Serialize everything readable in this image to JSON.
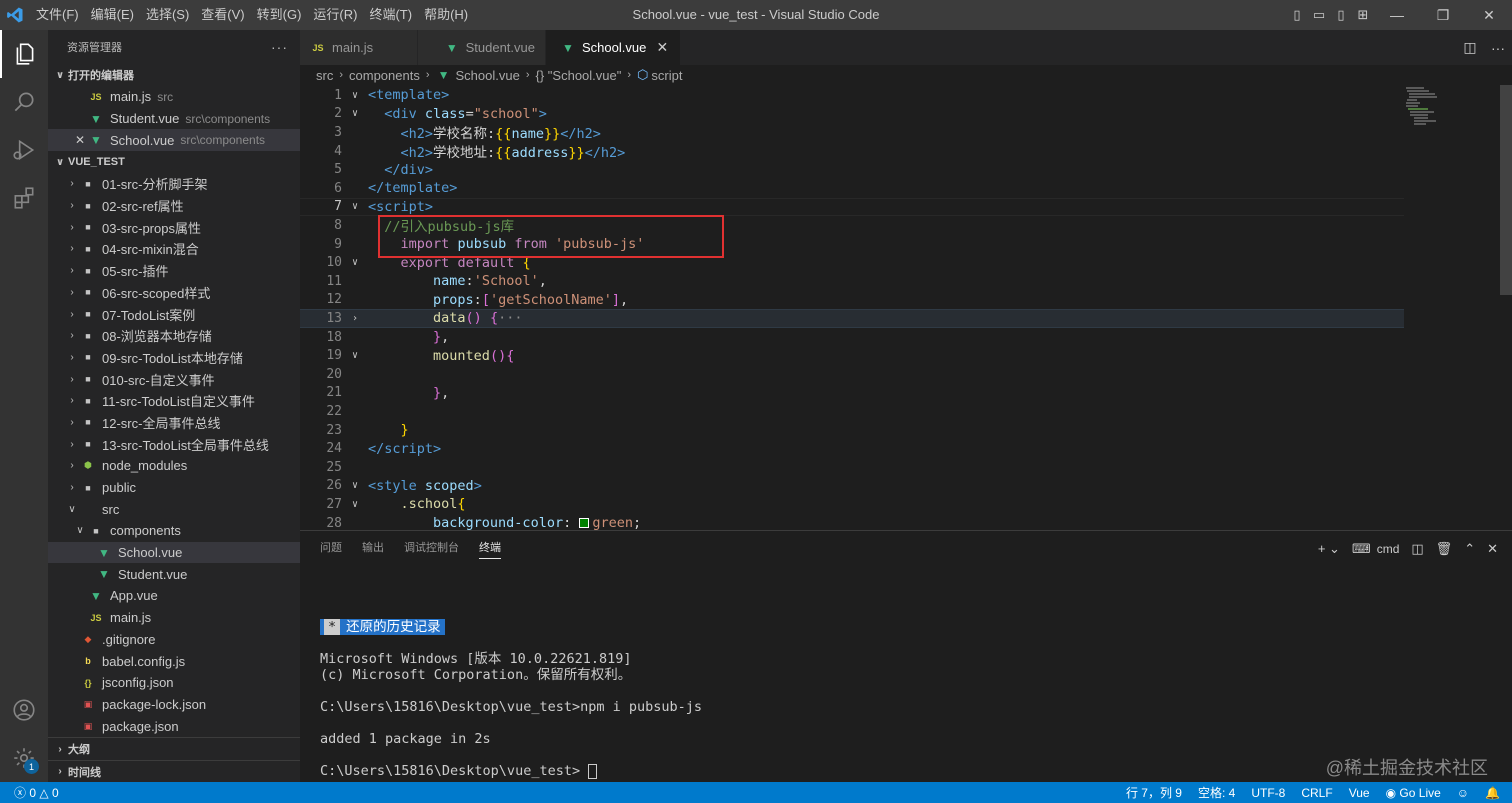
{
  "window": {
    "title": "School.vue - vue_test - Visual Studio Code",
    "menu": [
      "文件(F)",
      "编辑(E)",
      "选择(S)",
      "查看(V)",
      "转到(G)",
      "运行(R)",
      "终端(T)",
      "帮助(H)"
    ]
  },
  "sidebar": {
    "title": "资源管理器",
    "more": "···",
    "open_editors_title": "打开的编辑器",
    "open_editors": [
      {
        "name": "main.js",
        "desc": "src",
        "icon": "js-icon"
      },
      {
        "name": "Student.vue",
        "desc": "src\\components",
        "icon": "vue-icon"
      },
      {
        "name": "School.vue",
        "desc": "src\\components",
        "icon": "vue-icon"
      }
    ],
    "project_title": "VUE_TEST",
    "folders": [
      "01-src-分析脚手架",
      "02-src-ref属性",
      "03-src-props属性",
      "04-src-mixin混合",
      "05-src-插件",
      "06-src-scoped样式",
      "07-TodoList案例",
      "08-浏览器本地存储",
      "09-src-TodoList本地存储",
      "010-src-自定义事件",
      "11-src-TodoList自定义事件",
      "12-src-全局事件总线",
      "13-src-TodoList全局事件总线"
    ],
    "node_modules": "node_modules",
    "public": "public",
    "src": "src",
    "components": "components",
    "component_files": [
      "School.vue",
      "Student.vue"
    ],
    "src_files": [
      "App.vue",
      "main.js"
    ],
    "root_files": [
      ".gitignore",
      "babel.config.js",
      "jsconfig.json",
      "package-lock.json",
      "package.json"
    ],
    "outline": "大纲",
    "timeline": "时间线"
  },
  "tabs": [
    {
      "label": "main.js",
      "icon": "js-icon"
    },
    {
      "label": "Student.vue",
      "icon": "vue-icon"
    },
    {
      "label": "School.vue",
      "icon": "vue-icon"
    }
  ],
  "breadcrumb": [
    "src",
    "components",
    "School.vue",
    "{} \"School.vue\"",
    "script"
  ],
  "editor": {
    "line_numbers": [
      "1",
      "2",
      "3",
      "4",
      "5",
      "6",
      "7",
      "8",
      "9",
      "10",
      "11",
      "12",
      "13",
      "18",
      "19",
      "20",
      "21",
      "22",
      "23",
      "24",
      "25",
      "26",
      "27",
      "28"
    ]
  },
  "panel": {
    "tabs": [
      "问题",
      "输出",
      "调试控制台",
      "终端"
    ],
    "shell": "cmd",
    "restore_star": "*",
    "restore_label": "还原的历史记录",
    "terminal_lines": [
      "Microsoft Windows [版本 10.0.22621.819]",
      "(c) Microsoft Corporation。保留所有权利。",
      "C:\\Users\\15816\\Desktop\\vue_test>npm i pubsub-js",
      "added 1 package in 2s",
      "C:\\Users\\15816\\Desktop\\vue_test>"
    ],
    "watermark": "@稀土掘金技术社区"
  },
  "status": {
    "errors": "0",
    "warnings": "0",
    "position": "行 7，列 9",
    "indent": "空格: 4",
    "encoding": "UTF-8",
    "eol": "CRLF",
    "language": "Vue",
    "golive": "Go Live"
  },
  "activity": {
    "badge": "1"
  },
  "colors": {
    "accent": "#007acc",
    "highlight_box": "#e03131"
  }
}
